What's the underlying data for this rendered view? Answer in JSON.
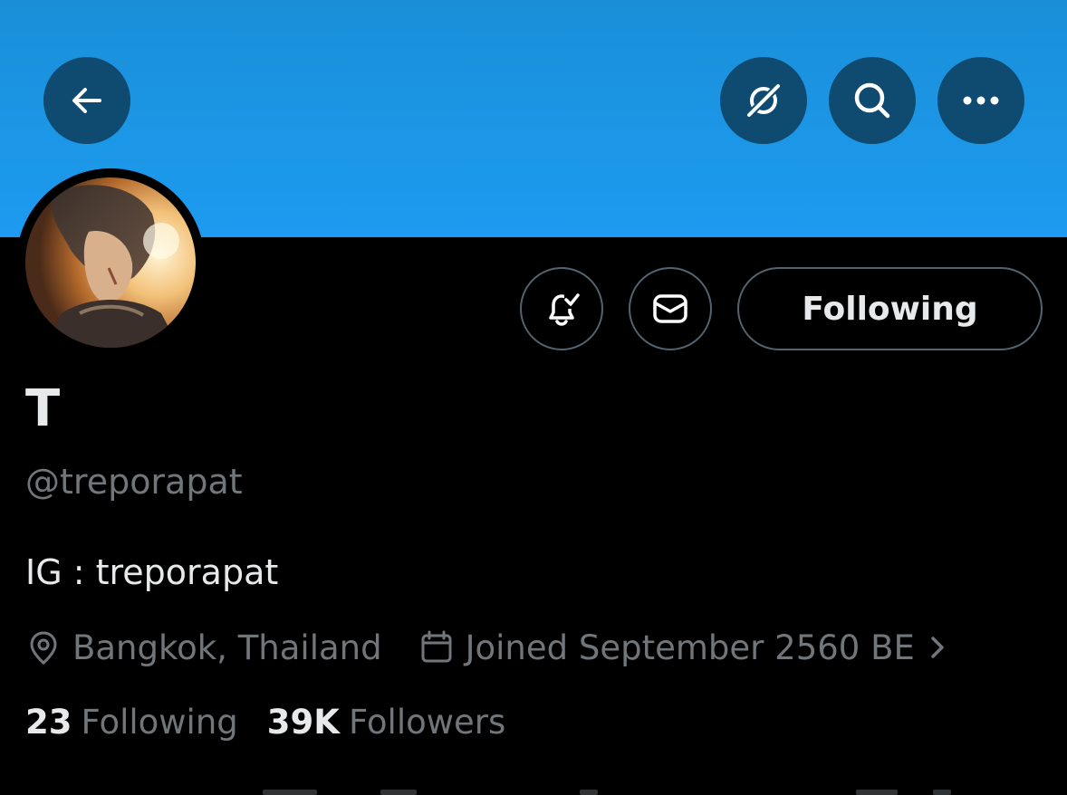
{
  "header": {
    "back_icon": "arrow-left-icon",
    "grok_icon": "grok-slash-icon",
    "search_icon": "search-icon",
    "more_icon": "more-horizontal-icon",
    "banner_color": "#1d9bf0",
    "button_bg": "#0f4a70"
  },
  "actions": {
    "notify_icon": "bell-check-icon",
    "message_icon": "envelope-icon",
    "following_label": "Following"
  },
  "profile": {
    "display_name": "T",
    "handle": "@treporapat",
    "bio": "IG : treporapat",
    "location": "Bangkok, Thailand",
    "joined": "Joined September 2560 BE",
    "location_icon": "location-pin-icon",
    "calendar_icon": "calendar-icon",
    "chevron_icon": "chevron-right-icon"
  },
  "stats": {
    "following_count": "23",
    "following_label": "Following",
    "followers_count": "39K",
    "followers_label": "Followers"
  },
  "colors": {
    "background": "#000000",
    "primary_text": "#e7e9ea",
    "secondary_text": "#71767b",
    "border": "#536471"
  }
}
